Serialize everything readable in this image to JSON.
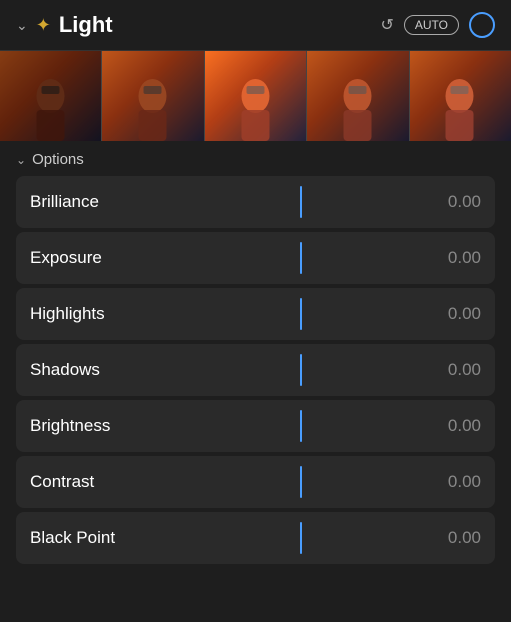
{
  "header": {
    "title": "Light",
    "auto_label": "AUTO",
    "chevron": "›",
    "sun_symbol": "☀"
  },
  "options_label": "Options",
  "sliders": [
    {
      "label": "Brilliance",
      "value": "0.00"
    },
    {
      "label": "Exposure",
      "value": "0.00"
    },
    {
      "label": "Highlights",
      "value": "0.00"
    },
    {
      "label": "Shadows",
      "value": "0.00"
    },
    {
      "label": "Brightness",
      "value": "0.00"
    },
    {
      "label": "Contrast",
      "value": "0.00"
    },
    {
      "label": "Black Point",
      "value": "0.00"
    }
  ],
  "colors": {
    "accent": "#4a9eff",
    "background": "#1e1e1e",
    "row_bg": "#2a2a2a",
    "label": "#ffffff",
    "value": "#888888"
  }
}
